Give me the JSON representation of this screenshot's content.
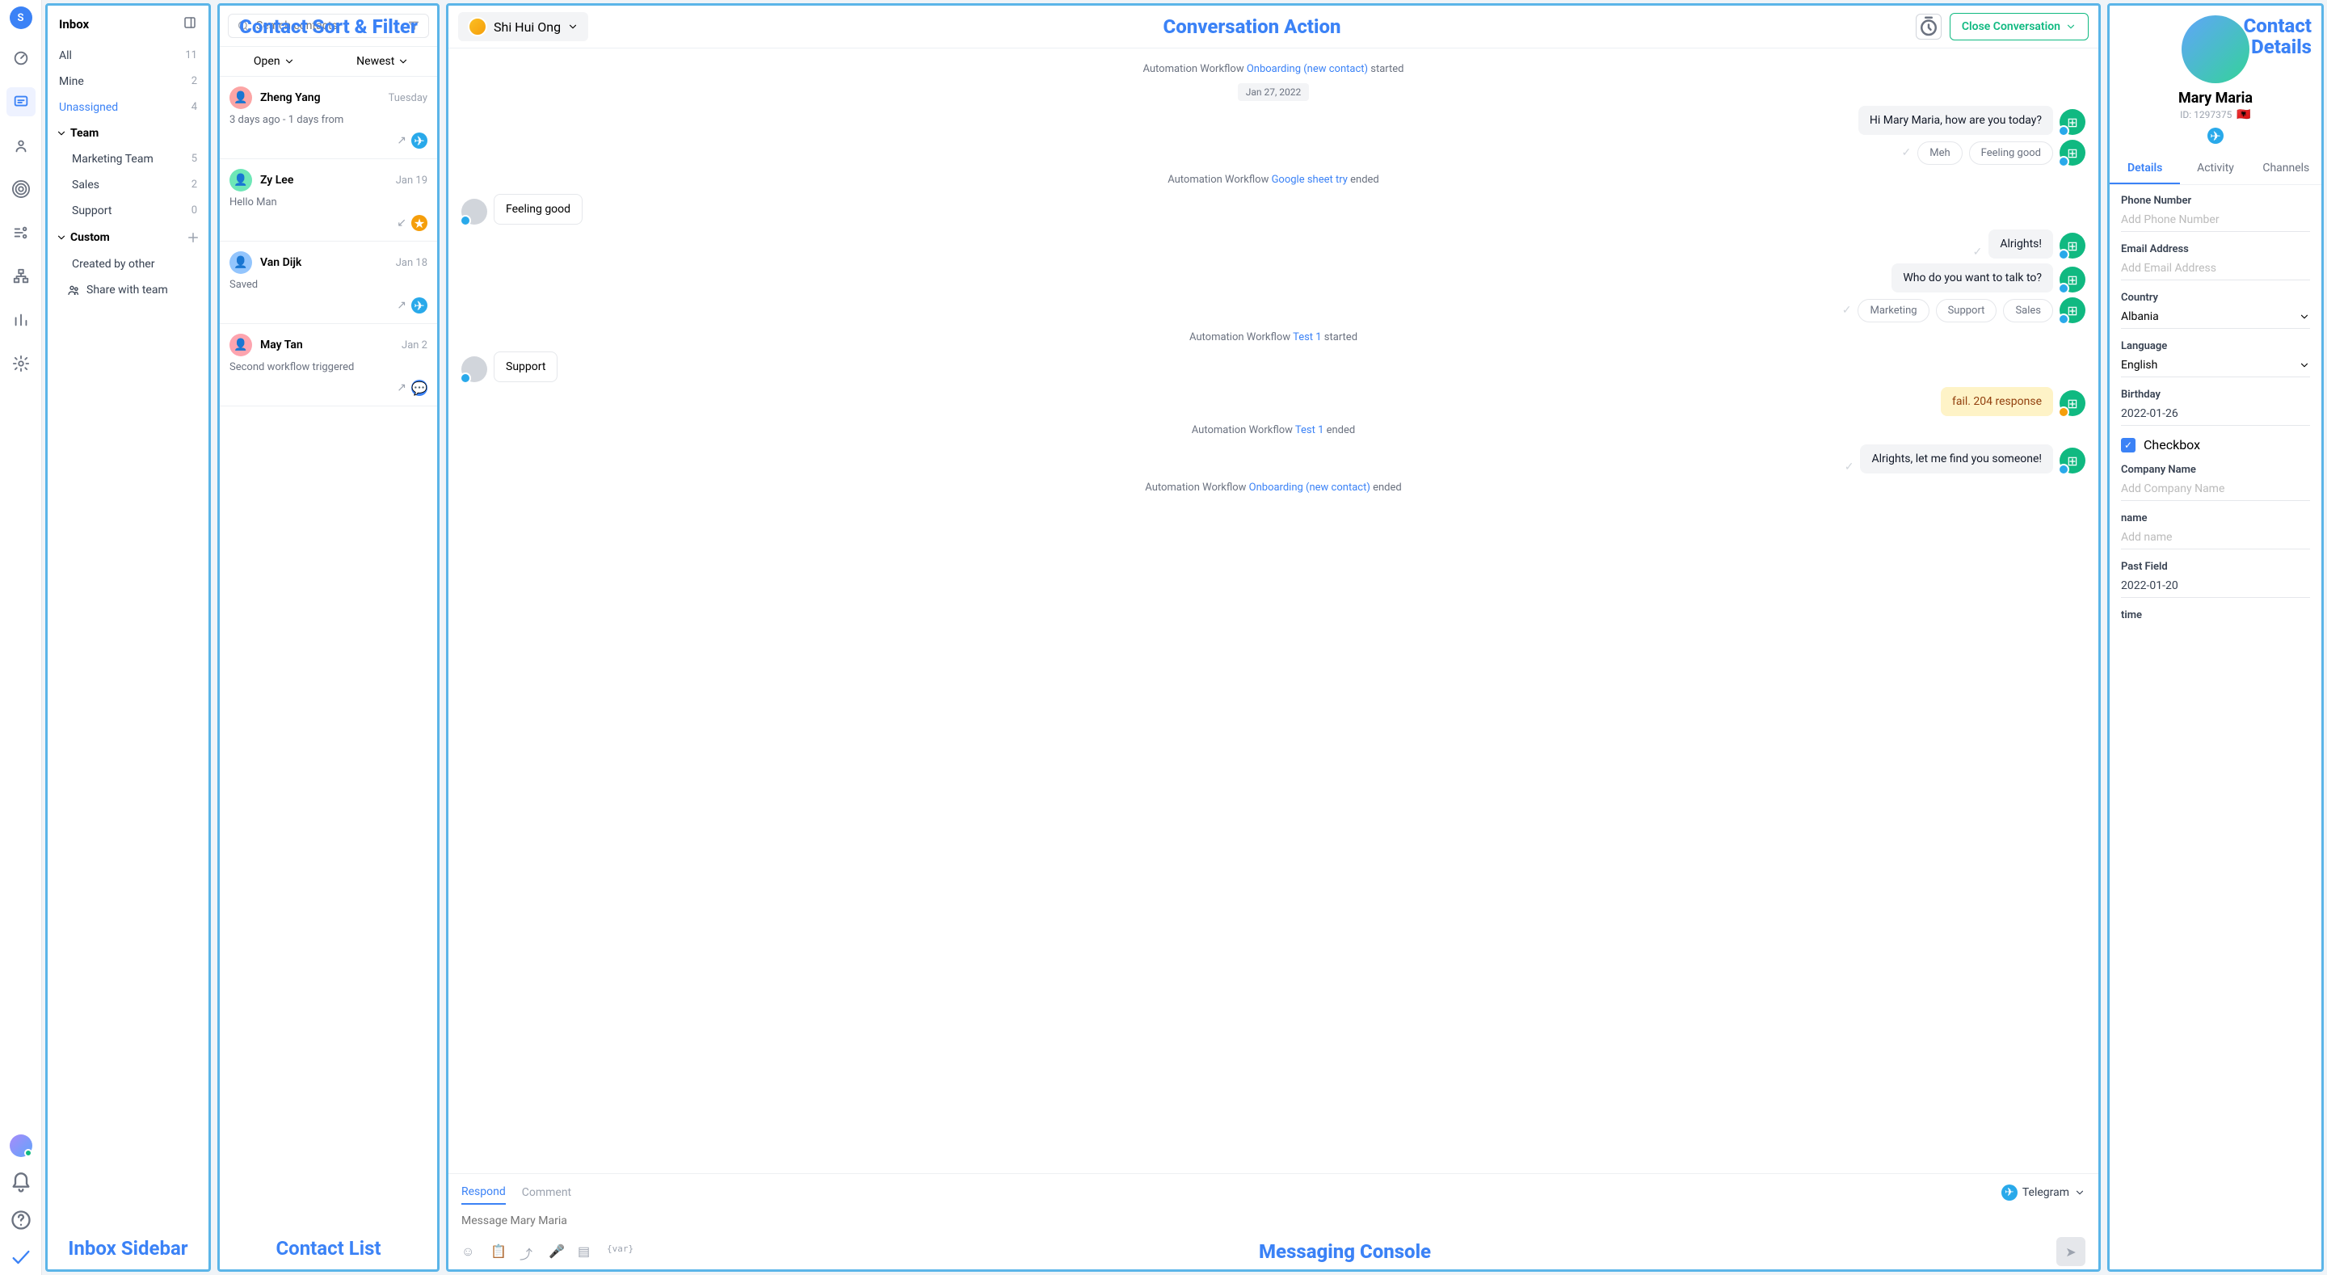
{
  "rail": {
    "initial": "S"
  },
  "inbox": {
    "title": "Inbox",
    "items": [
      {
        "label": "All",
        "count": "11"
      },
      {
        "label": "Mine",
        "count": "2"
      },
      {
        "label": "Unassigned",
        "count": "4"
      }
    ],
    "team": {
      "label": "Team",
      "items": [
        {
          "label": "Marketing Team",
          "count": "5"
        },
        {
          "label": "Sales",
          "count": "2"
        },
        {
          "label": "Support",
          "count": "0"
        }
      ]
    },
    "custom": {
      "label": "Custom",
      "items": [
        {
          "label": "Created by other"
        },
        {
          "label": "Share with team"
        }
      ]
    },
    "panel_label": "Inbox Sidebar"
  },
  "contacts": {
    "overlay_title": "Contact Sort & Filter",
    "search_placeholder": "Search contacts",
    "filters": {
      "open": "Open",
      "newest": "Newest"
    },
    "list": [
      {
        "name": "Zheng Yang",
        "date": "Tuesday",
        "preview": "3 days ago - 1 days from",
        "arrow": "↗",
        "channel": "tg"
      },
      {
        "name": "Zy Lee",
        "date": "Jan 19",
        "preview": "Hello Man",
        "arrow": "↙",
        "channel": "fc"
      },
      {
        "name": "Van Dijk",
        "date": "Jan 18",
        "preview": "Saved",
        "arrow": "↗",
        "channel": "tg"
      },
      {
        "name": "May Tan",
        "date": "Jan 2",
        "preview": "Second workflow triggered",
        "arrow": "↗",
        "channel": "cm"
      }
    ],
    "panel_label": "Contact List"
  },
  "console": {
    "assignee": "Shi Hui Ong",
    "overlay_title": "Conversation Action",
    "close_label": "Close Conversation",
    "workflow_prefix": "Automation Workflow ",
    "wf1": {
      "link": "Onboarding (new contact)",
      "suffix": " started"
    },
    "date_chip": "Jan 27, 2022",
    "msg1": "Hi Mary Maria, how are you today?",
    "qr1": {
      "a": "Meh",
      "b": "Feeling good"
    },
    "wf2": {
      "link": "Google sheet try",
      "suffix": " ended"
    },
    "msg2": "Feeling good",
    "msg3": "Alrights!",
    "msg4": "Who do you want to talk to?",
    "qr2": {
      "a": "Marketing",
      "b": "Support",
      "c": "Sales"
    },
    "wf3": {
      "link": "Test 1",
      "suffix": " started"
    },
    "msg5": "Support",
    "msg6": "fail. 204 response",
    "wf4": {
      "link": "Test 1",
      "suffix": " ended"
    },
    "msg7": "Alrights, let me find you someone!",
    "wf5": {
      "link": "Onboarding (new contact)",
      "suffix": " ended"
    },
    "compose": {
      "tabs": {
        "respond": "Respond",
        "comment": "Comment"
      },
      "channel": "Telegram",
      "placeholder": "Message Mary Maria",
      "panel_label": "Messaging Console",
      "var_icon": "{var}"
    }
  },
  "details": {
    "overlay_title_1": "Contact",
    "overlay_title_2": "Details",
    "name": "Mary Maria",
    "id_label": "ID: 1297375",
    "flag": "🇦🇱",
    "tabs": {
      "details": "Details",
      "activity": "Activity",
      "channels": "Channels"
    },
    "fields": {
      "phone": {
        "label": "Phone Number",
        "placeholder": "Add Phone Number"
      },
      "email": {
        "label": "Email Address",
        "placeholder": "Add Email Address"
      },
      "country": {
        "label": "Country",
        "value": "Albania"
      },
      "language": {
        "label": "Language",
        "value": "English"
      },
      "birthday": {
        "label": "Birthday",
        "value": "2022-01-26"
      },
      "checkbox": {
        "label": "Checkbox"
      },
      "company": {
        "label": "Company Name",
        "placeholder": "Add Company Name"
      },
      "name_f": {
        "label": "name",
        "placeholder": "Add name"
      },
      "past": {
        "label": "Past Field",
        "value": "2022-01-20"
      },
      "time": {
        "label": "time"
      }
    }
  }
}
